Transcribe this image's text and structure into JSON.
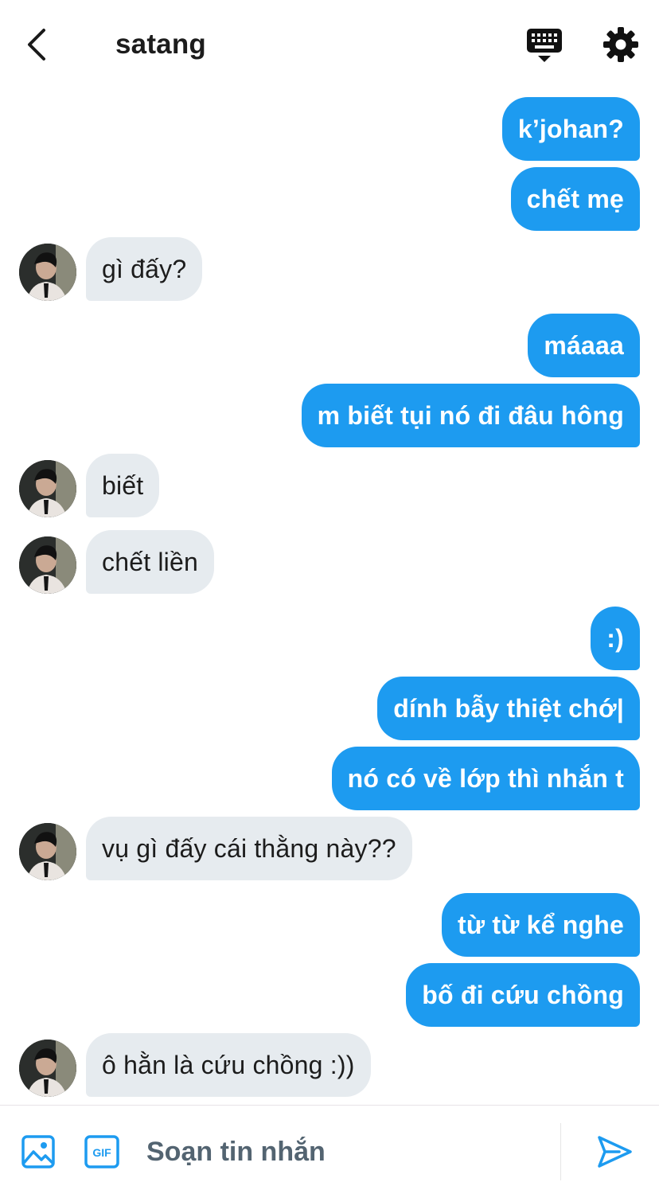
{
  "header": {
    "title": "satang",
    "back_icon": "chevron-left-icon",
    "keyboard_icon": "keyboard-icon",
    "settings_icon": "gear-icon"
  },
  "colors": {
    "accent": "#1d9bf0",
    "incoming_bubble": "#e6ebef",
    "text": "#1c1c1c",
    "muted": "#536471"
  },
  "messages": [
    {
      "side": "out",
      "text": "k’johan?"
    },
    {
      "side": "out",
      "text": "chết mẹ"
    },
    {
      "side": "in",
      "text": "gì đấy?"
    },
    {
      "side": "out",
      "text": "máaaa"
    },
    {
      "side": "out",
      "text": "m biết tụi nó đi đâu hông"
    },
    {
      "side": "in",
      "text": "biết"
    },
    {
      "side": "in",
      "text": "chết liền"
    },
    {
      "side": "out",
      "text": ":)"
    },
    {
      "side": "out",
      "text": "dính bẫy thiệt chớ|"
    },
    {
      "side": "out",
      "text": "nó có về lớp thì nhắn t"
    },
    {
      "side": "in",
      "text": "vụ gì đấy cái thằng này??"
    },
    {
      "side": "out",
      "text": "từ từ kể nghe"
    },
    {
      "side": "out",
      "text": "bố đi cứu chồng"
    },
    {
      "side": "in",
      "text": "ô hằn là cứu chồng :))"
    }
  ],
  "composer": {
    "placeholder": "Soạn tin nhắn",
    "value": "",
    "image_icon": "image-icon",
    "gif_icon": "gif-icon",
    "gif_label": "GIF",
    "send_icon": "send-icon"
  }
}
